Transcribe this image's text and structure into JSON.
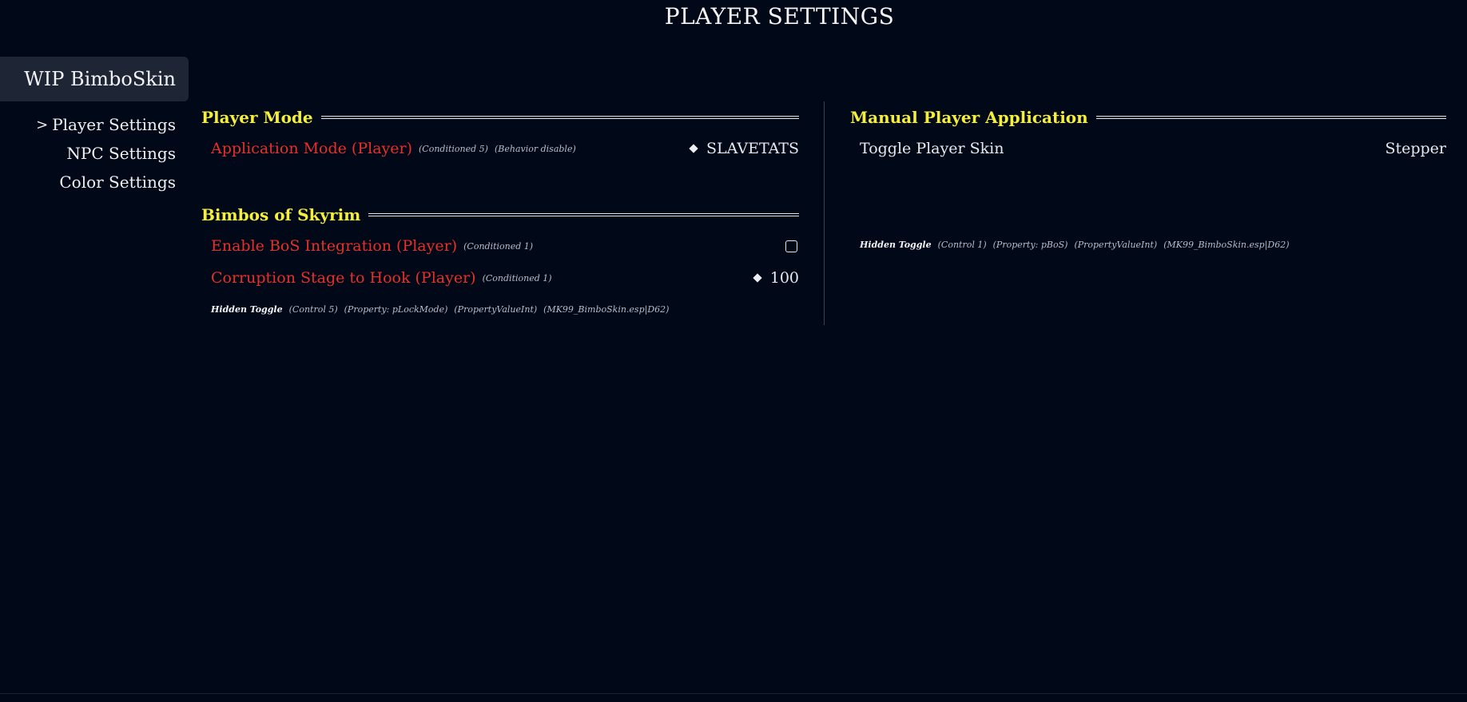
{
  "page": {
    "title": "PLAYER SETTINGS"
  },
  "mod": {
    "name": "WIP BimboSkin"
  },
  "nav": {
    "chevron": ">",
    "items": [
      {
        "label": "Player Settings",
        "active": true
      },
      {
        "label": "NPC Settings",
        "active": false
      },
      {
        "label": "Color Settings",
        "active": false
      }
    ]
  },
  "left": {
    "player_mode": {
      "title": "Player Mode",
      "application_mode": {
        "label": "Application Mode (Player)",
        "tag1": "(Conditioned 5)",
        "tag2": "(Behavior disable)",
        "value": "SLAVETATS"
      }
    },
    "bimbos": {
      "title": "Bimbos of Skyrim",
      "enable_bos": {
        "label": "Enable BoS Integration (Player)",
        "tag1": "(Conditioned 1)",
        "checked": false
      },
      "corruption": {
        "label": "Corruption Stage to Hook (Player)",
        "tag1": "(Conditioned 1)",
        "value": "100"
      },
      "hidden": {
        "title": "Hidden Toggle",
        "meta": [
          "(Control 5)",
          "(Property: pLockMode)",
          "(PropertyValueInt)",
          "(MK99_BimboSkin.esp|D62)"
        ]
      }
    }
  },
  "right": {
    "manual": {
      "title": "Manual Player Application",
      "toggle_skin": {
        "label": "Toggle Player Skin",
        "value": "Stepper"
      },
      "hidden": {
        "title": "Hidden Toggle",
        "meta": [
          "(Control 1)",
          "(Property: pBoS)",
          "(PropertyValueInt)",
          "(MK99_BimboSkin.esp|D62)"
        ]
      }
    }
  },
  "colors": {
    "background": "#010817",
    "section_title": "#f5ee3c",
    "conditioned_label": "#e8302a",
    "tab_background": "#1e2636"
  }
}
